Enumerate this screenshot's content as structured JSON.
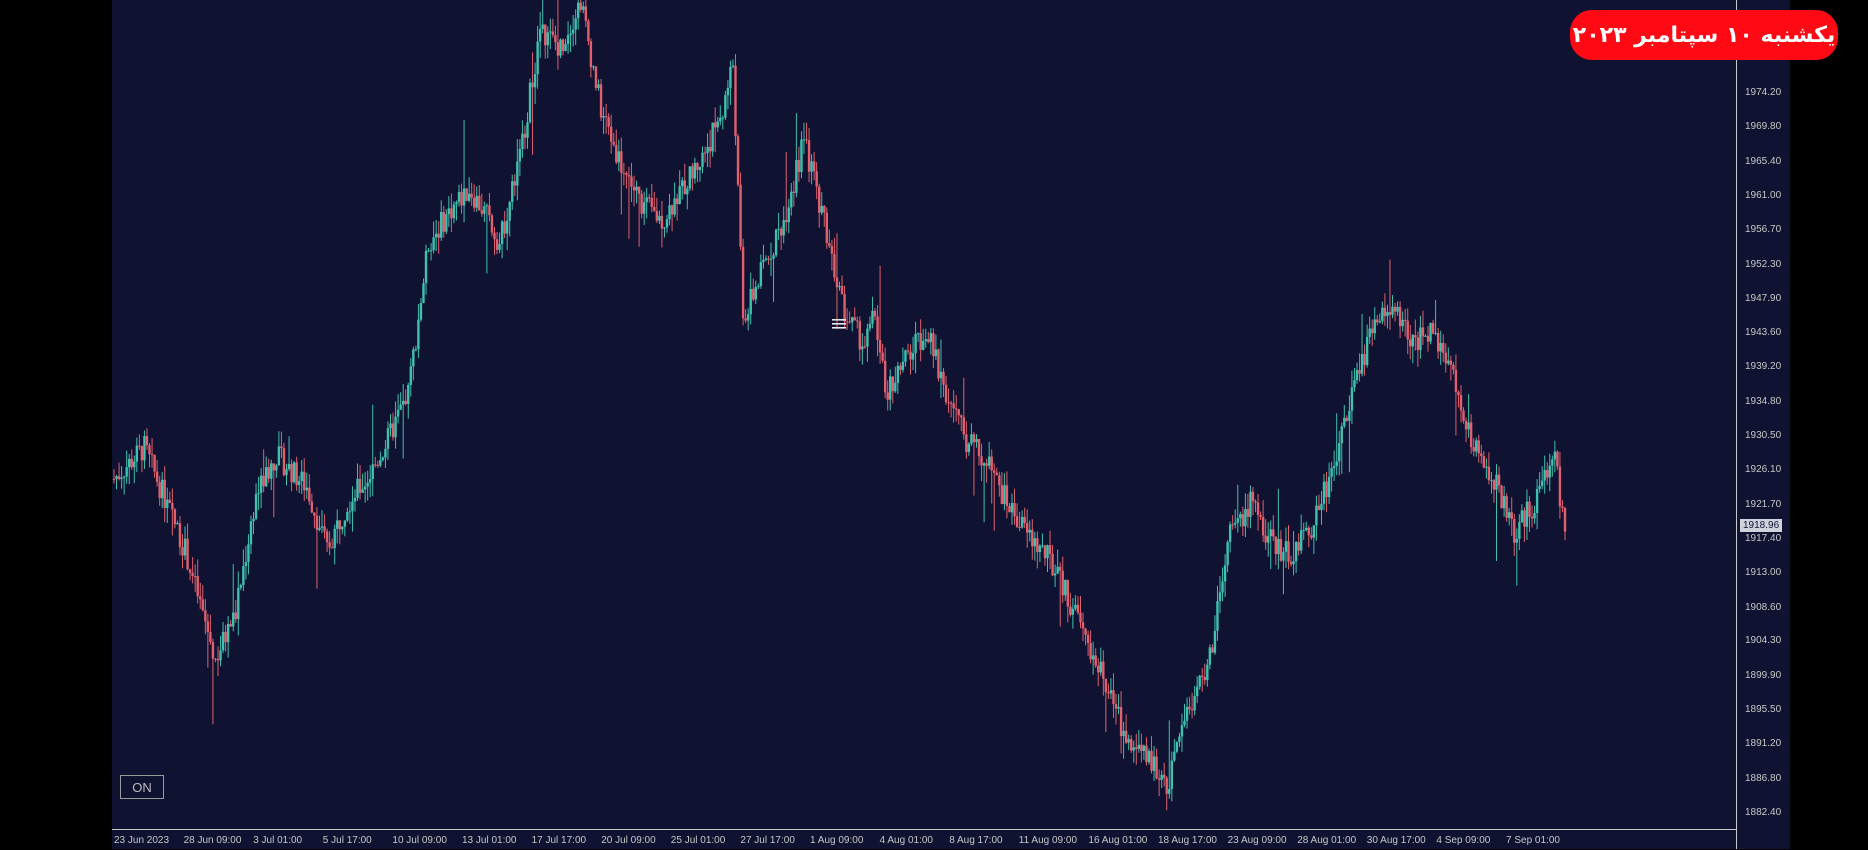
{
  "date_badge": "یکشنبه ۱۰ سپتامبر ۲۰۲۳",
  "on_button": "ON",
  "current_price_tag": "1918.96",
  "colors": {
    "background": "#0f1230",
    "bull": "#3fc1b0",
    "bear": "#e0606e",
    "axis": "#c9c9c9",
    "badge": "#ff0a14"
  },
  "chart_data": {
    "type": "candlestick",
    "ylim": [
      1880.4,
      1986.0
    ],
    "current_price": 1918.96,
    "y_ticks": [
      "1974.20",
      "1969.80",
      "1965.40",
      "1961.00",
      "1956.70",
      "1952.30",
      "1947.90",
      "1943.60",
      "1939.20",
      "1934.80",
      "1930.50",
      "1926.10",
      "1921.70",
      "1917.40",
      "1913.00",
      "1908.60",
      "1904.30",
      "1899.90",
      "1895.50",
      "1891.20",
      "1886.80",
      "1882.40"
    ],
    "x_ticks": [
      "23 Jun 2023",
      "28 Jun 09:00",
      "3 Jul 01:00",
      "5 Jul 17:00",
      "10 Jul 09:00",
      "13 Jul 01:00",
      "17 Jul 17:00",
      "20 Jul 09:00",
      "25 Jul 01:00",
      "27 Jul 17:00",
      "1 Aug 09:00",
      "4 Aug 01:00",
      "8 Aug 17:00",
      "11 Aug 09:00",
      "16 Aug 01:00",
      "18 Aug 17:00",
      "23 Aug 09:00",
      "28 Aug 01:00",
      "30 Aug 17:00",
      "4 Sep 09:00",
      "7 Sep 01:00"
    ],
    "price_path": [
      [
        0,
        1925
      ],
      [
        6,
        1929
      ],
      [
        14,
        1916
      ],
      [
        20,
        1902
      ],
      [
        24,
        1908
      ],
      [
        28,
        1923
      ],
      [
        32,
        1928
      ],
      [
        38,
        1924
      ],
      [
        42,
        1916
      ],
      [
        46,
        1922
      ],
      [
        50,
        1925
      ],
      [
        54,
        1930
      ],
      [
        58,
        1936
      ],
      [
        62,
        1955
      ],
      [
        66,
        1959
      ],
      [
        70,
        1962
      ],
      [
        74,
        1958
      ],
      [
        76,
        1955
      ],
      [
        80,
        1966
      ],
      [
        84,
        1982
      ],
      [
        88,
        1980
      ],
      [
        92,
        1986
      ],
      [
        96,
        1972
      ],
      [
        100,
        1965
      ],
      [
        104,
        1960
      ],
      [
        108,
        1958
      ],
      [
        112,
        1962
      ],
      [
        116,
        1966
      ],
      [
        120,
        1972
      ],
      [
        122,
        1978
      ],
      [
        124,
        1945
      ],
      [
        128,
        1952
      ],
      [
        132,
        1958
      ],
      [
        136,
        1968
      ],
      [
        140,
        1958
      ],
      [
        144,
        1946
      ],
      [
        148,
        1942
      ],
      [
        150,
        1946
      ],
      [
        152,
        1936
      ],
      [
        156,
        1940
      ],
      [
        160,
        1944
      ],
      [
        164,
        1936
      ],
      [
        168,
        1930
      ],
      [
        172,
        1927
      ],
      [
        176,
        1922
      ],
      [
        180,
        1918
      ],
      [
        184,
        1915
      ],
      [
        188,
        1910
      ],
      [
        192,
        1904
      ],
      [
        196,
        1898
      ],
      [
        200,
        1891
      ],
      [
        204,
        1889
      ],
      [
        208,
        1886
      ],
      [
        210,
        1893
      ],
      [
        212,
        1896
      ],
      [
        216,
        1902
      ],
      [
        220,
        1918
      ],
      [
        224,
        1922
      ],
      [
        228,
        1917
      ],
      [
        232,
        1915
      ],
      [
        236,
        1919
      ],
      [
        240,
        1926
      ],
      [
        244,
        1936
      ],
      [
        248,
        1944
      ],
      [
        252,
        1947
      ],
      [
        256,
        1942
      ],
      [
        260,
        1944
      ],
      [
        264,
        1938
      ],
      [
        268,
        1929
      ],
      [
        272,
        1925
      ],
      [
        276,
        1918
      ],
      [
        280,
        1922
      ],
      [
        284,
        1928
      ],
      [
        286,
        1918
      ]
    ]
  }
}
